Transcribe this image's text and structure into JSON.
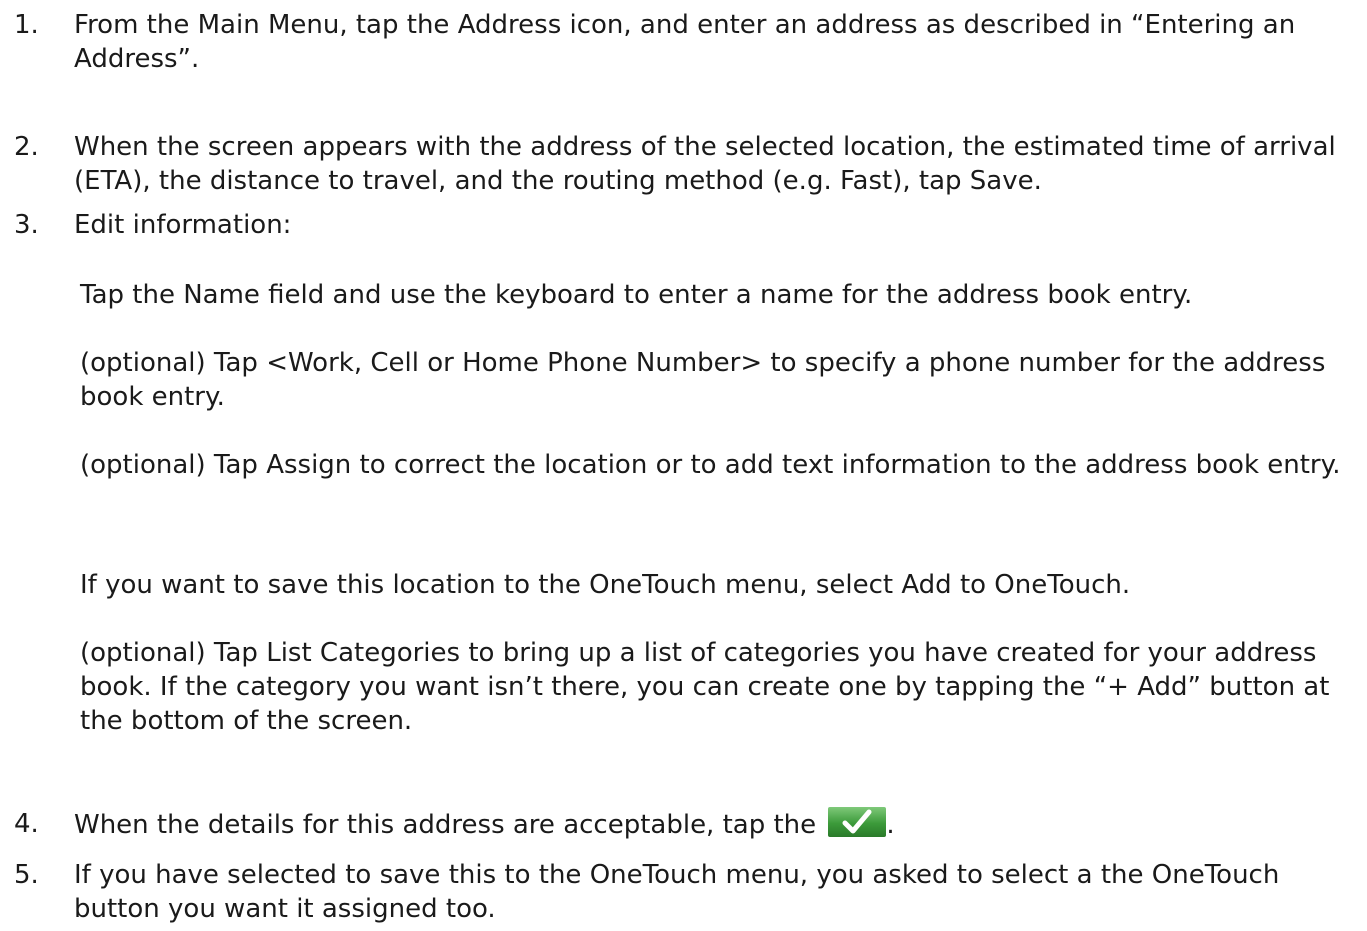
{
  "steps": [
    {
      "num": "1.",
      "text": "From the Main Menu, tap the Address icon, and enter an address as described in “Entering an Address”."
    },
    {
      "num": "2.",
      "text": "When the screen appears with the address of the selected location, the estimated time of arrival (ETA), the distance to travel, and the routing method (e.g. Fast), tap Save."
    },
    {
      "num": "3.",
      "text": "Edit information:"
    },
    {
      "num": "4.",
      "text_before": "When the details for this address are acceptable, tap the ",
      "text_after": "."
    },
    {
      "num": "5.",
      "text": "If you have selected to save this to the OneTouch menu, you asked to select a the OneTouch button you want it assigned too."
    }
  ],
  "substeps": [
    "Tap the Name field and use the keyboard to enter a name for the address book entry.",
    "(optional) Tap <Work, Cell or Home Phone Number> to specify a phone number for the address book entry.",
    "(optional) Tap Assign to correct the location or to add text information to the address book entry.",
    "If you want to save this location to the OneTouch menu, select Add to OneTouch.",
    "(optional) Tap List Categories to bring up a list of categories you have created for your address book.  If the category you want isn’t there, you can create one by tapping the “+ Add” button at the bottom of the screen."
  ],
  "icons": {
    "checkmark": "checkmark-icon",
    "checkmark_color": "#3c9a3a"
  }
}
